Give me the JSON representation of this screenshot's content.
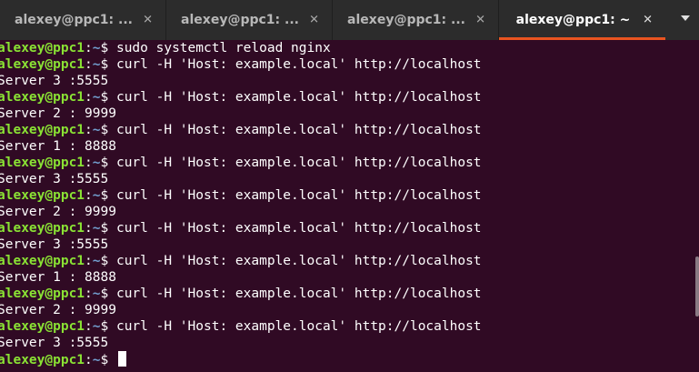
{
  "tabs": [
    {
      "title": "alexey@ppc1: ...",
      "close": "✕",
      "active": false
    },
    {
      "title": "alexey@ppc1: ...",
      "close": "✕",
      "active": false
    },
    {
      "title": "alexey@ppc1: ...",
      "close": "✕",
      "active": false
    },
    {
      "title": "alexey@ppc1: ~",
      "close": "✕",
      "active": true
    }
  ],
  "menu_icon": "chevron-down-icon",
  "colors": {
    "background": "#300a24",
    "tabbar": "#2c2c2c",
    "accent": "#e95420",
    "prompt_user": "#8ae234",
    "prompt_path": "#729fcf"
  },
  "terminal": {
    "prompt": {
      "user_host": "alexey@ppc1",
      "sep": ":",
      "path": "~",
      "symbol": "$ "
    },
    "lines": [
      {
        "type": "cmd",
        "text": "sudo systemctl reload nginx"
      },
      {
        "type": "cmd",
        "text": "curl -H 'Host: example.local' http://localhost"
      },
      {
        "type": "out",
        "text": "Server 3 :5555"
      },
      {
        "type": "cmd",
        "text": "curl -H 'Host: example.local' http://localhost"
      },
      {
        "type": "out",
        "text": "Server 2 : 9999"
      },
      {
        "type": "cmd",
        "text": "curl -H 'Host: example.local' http://localhost"
      },
      {
        "type": "out",
        "text": "Server 1 : 8888"
      },
      {
        "type": "cmd",
        "text": "curl -H 'Host: example.local' http://localhost"
      },
      {
        "type": "out",
        "text": "Server 3 :5555"
      },
      {
        "type": "cmd",
        "text": "curl -H 'Host: example.local' http://localhost"
      },
      {
        "type": "out",
        "text": "Server 2 : 9999"
      },
      {
        "type": "cmd",
        "text": "curl -H 'Host: example.local' http://localhost"
      },
      {
        "type": "out",
        "text": "Server 3 :5555"
      },
      {
        "type": "cmd",
        "text": "curl -H 'Host: example.local' http://localhost"
      },
      {
        "type": "out",
        "text": "Server 1 : 8888"
      },
      {
        "type": "cmd",
        "text": "curl -H 'Host: example.local' http://localhost"
      },
      {
        "type": "out",
        "text": "Server 2 : 9999"
      },
      {
        "type": "cmd",
        "text": "curl -H 'Host: example.local' http://localhost"
      },
      {
        "type": "out",
        "text": "Server 3 :5555"
      },
      {
        "type": "cmd",
        "text": ""
      }
    ]
  }
}
